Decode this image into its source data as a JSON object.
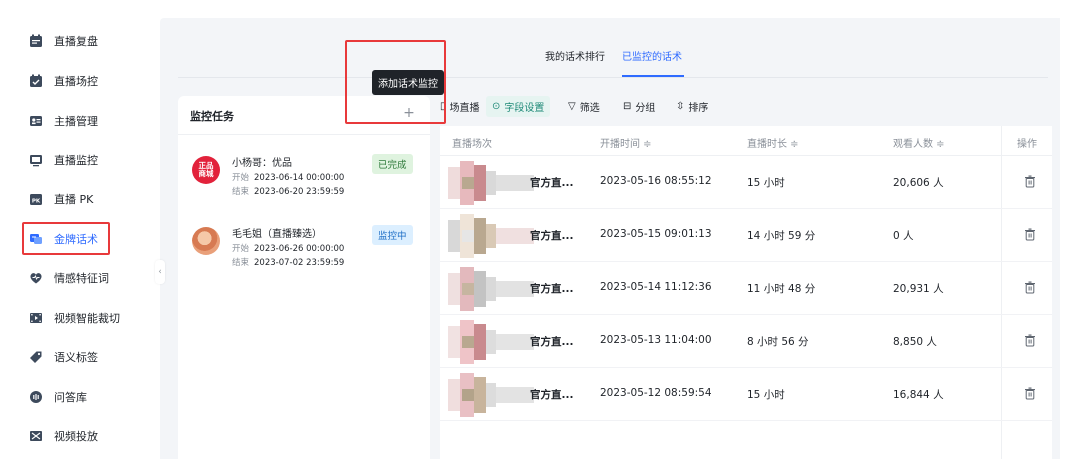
{
  "sidebar": {
    "items": [
      {
        "label": "直播复盘",
        "icon": "calendar-icon",
        "active": false
      },
      {
        "label": "直播场控",
        "icon": "calendar-check-icon",
        "active": false
      },
      {
        "label": "主播管理",
        "icon": "id-card-icon",
        "active": false
      },
      {
        "label": "直播监控",
        "icon": "monitor-icon",
        "active": false
      },
      {
        "label": "直播 PK",
        "icon": "pk-icon",
        "active": false
      },
      {
        "label": "金牌话术",
        "icon": "speech-card-icon",
        "active": true
      },
      {
        "label": "情感特征词",
        "icon": "heart-icon",
        "active": false
      },
      {
        "label": "视频智能裁切",
        "icon": "film-icon",
        "active": false
      },
      {
        "label": "语义标签",
        "icon": "tag-icon",
        "active": false
      },
      {
        "label": "问答库",
        "icon": "qa-icon",
        "active": false
      },
      {
        "label": "视频投放",
        "icon": "video-delivery-icon",
        "active": false
      }
    ]
  },
  "tabs": [
    {
      "label": "我的话术排行",
      "active": false
    },
    {
      "label": "已监控的话术",
      "active": true
    }
  ],
  "tooltip": "添加话术监控",
  "task_panel": {
    "title": "监控任务",
    "add_symbol": "+",
    "tasks": [
      {
        "avatar_text": "正品\n商城",
        "name": "小杨哥：优品",
        "start_label": "开始",
        "start": "2023-06-14 00:00:00",
        "end_label": "结束",
        "end": "2023-06-20 23:59:59",
        "status": "已完成"
      },
      {
        "avatar_text": "",
        "name": "毛毛姐（直播臻选）",
        "start_label": "开始",
        "start": "2023-06-26 00:00:00",
        "end_label": "结束",
        "end": "2023-07-02 23:59:59",
        "status": "监控中"
      }
    ]
  },
  "toolbar": {
    "scene_label": "场直播",
    "fields_label": "字段设置",
    "filter_label": "筛选",
    "group_label": "分组",
    "sort_label": "排序"
  },
  "table": {
    "headers": [
      "直播场次",
      "开播时间 ≑",
      "直播时长 ≑",
      "观看人数 ≑",
      "操作"
    ],
    "rows": [
      {
        "session": "官方直...",
        "start": "2023-05-16 08:55:12",
        "duration": "15 小时",
        "viewers": "20,606 人"
      },
      {
        "session": "官方直...",
        "start": "2023-05-15 09:01:13",
        "duration": "14 小时 59 分",
        "viewers": "0 人"
      },
      {
        "session": "官方直...",
        "start": "2023-05-14 11:12:36",
        "duration": "11 小时 48 分",
        "viewers": "20,931 人"
      },
      {
        "session": "官方直...",
        "start": "2023-05-13 11:04:00",
        "duration": "8 小时 56 分",
        "viewers": "8,850 人"
      },
      {
        "session": "官方直...",
        "start": "2023-05-12 08:59:54",
        "duration": "15 小时",
        "viewers": "16,844 人"
      }
    ]
  },
  "colors": {
    "accent": "#2f6bff",
    "highlight": "#e8393b",
    "done_badge": "#dff3df",
    "live_badge": "#dcefff",
    "panel_bg": "#f3f5f8"
  }
}
